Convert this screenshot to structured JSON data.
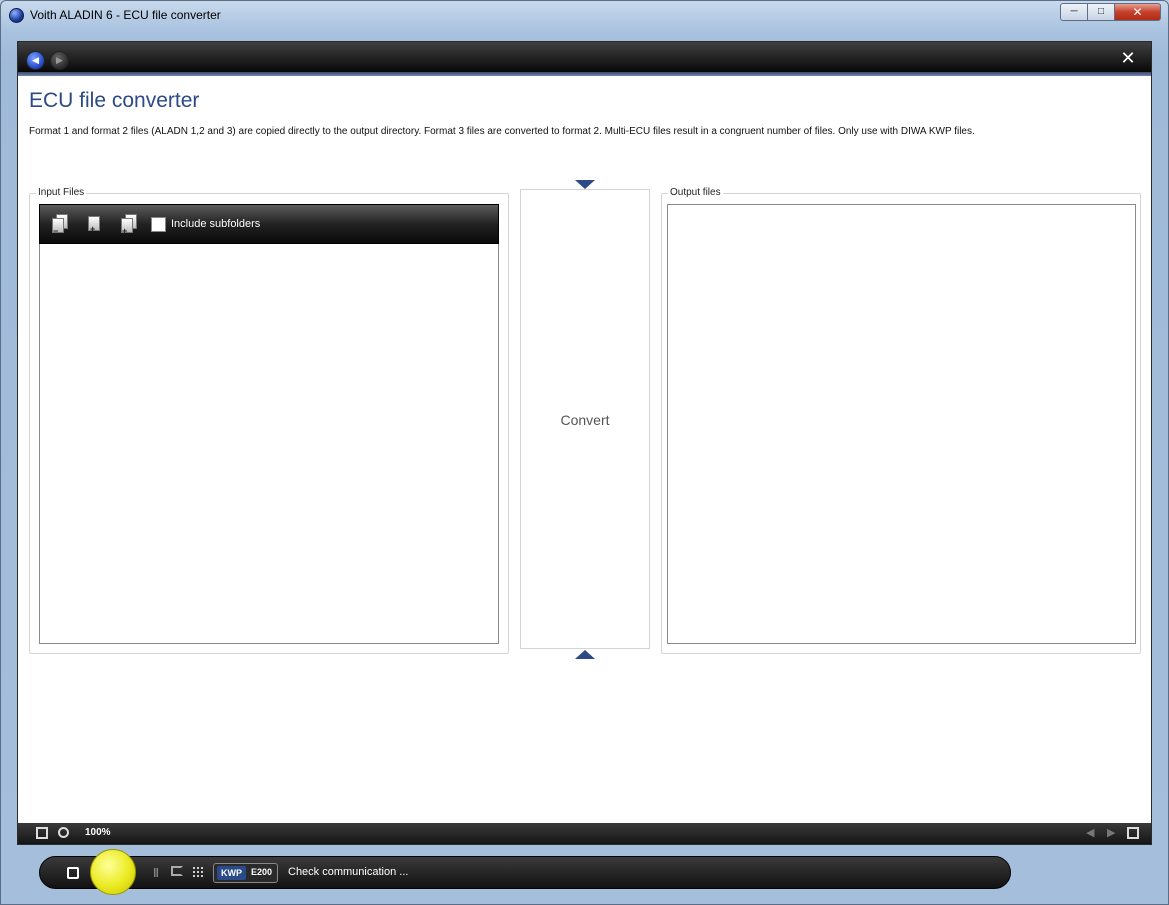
{
  "window": {
    "title": "Voith ALADIN 6 - ECU file converter",
    "min_glyph": "─",
    "max_glyph": "□",
    "close_glyph": "✕"
  },
  "nav": {
    "back_glyph": "◀",
    "forward_glyph": "▶",
    "close_glyph": "✕"
  },
  "page": {
    "title": "ECU file converter",
    "description": "Format 1 and format 2 files (ALADN 1,2 and 3) are copied directly to the output directory. Format 3 files are converted to format 2. Multi-ECU files result in a congruent number of files. Only use with DIWA KWP files."
  },
  "input_group": {
    "legend": "Input Files",
    "include_subfolders_label": "Include subfolders",
    "include_subfolders_checked": false
  },
  "convert": {
    "label": "Convert"
  },
  "output_group": {
    "legend": "Output files"
  },
  "statusbar": {
    "zoom": "100%",
    "prev_glyph": "◀",
    "next_glyph": "▶"
  },
  "dock": {
    "protocol": "KWP",
    "ecu": "E200",
    "status": "Check communication ...",
    "pause_glyph": "‖",
    "led_color": "#e8e820"
  },
  "colors": {
    "accent": "#2b4a86",
    "kwp_badge": "#2a4a8a"
  }
}
